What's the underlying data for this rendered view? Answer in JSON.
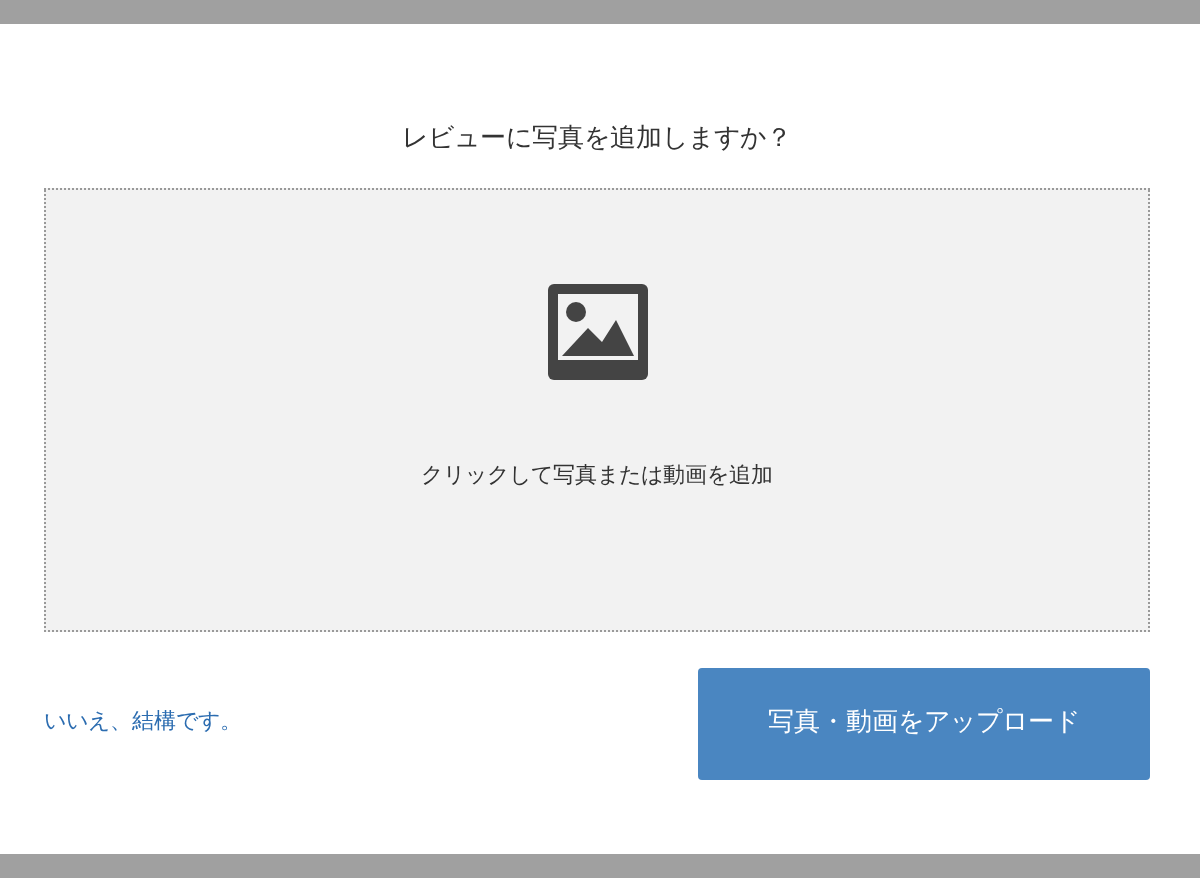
{
  "dialog": {
    "title": "レビューに写真を追加しますか？",
    "dropzone": {
      "label": "クリックして写真または動画を追加"
    },
    "decline_link": "いいえ、結構です。",
    "upload_button": "写真・動画をアップロード"
  }
}
